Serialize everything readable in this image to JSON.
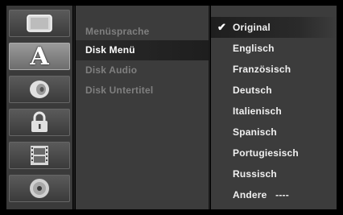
{
  "icons": [
    {
      "name": "tv-screen-icon"
    },
    {
      "name": "language-a-icon",
      "glyph": "A"
    },
    {
      "name": "speaker-icon"
    },
    {
      "name": "lock-icon"
    },
    {
      "name": "film-icon"
    },
    {
      "name": "disc-icon"
    }
  ],
  "menu": {
    "items": [
      {
        "label": "Menüsprache"
      },
      {
        "label": "Disk Menü"
      },
      {
        "label": "Disk Audio"
      },
      {
        "label": "Disk Untertitel"
      }
    ],
    "selected_index": 1
  },
  "options": {
    "checkmark": "✔",
    "items": [
      {
        "label": "Original"
      },
      {
        "label": "Englisch"
      },
      {
        "label": "Französisch"
      },
      {
        "label": "Deutsch"
      },
      {
        "label": "Italienisch"
      },
      {
        "label": "Spanisch"
      },
      {
        "label": "Portugiesisch"
      },
      {
        "label": "Russisch"
      },
      {
        "label": "Andere   ----"
      }
    ],
    "selected_index": 0
  }
}
